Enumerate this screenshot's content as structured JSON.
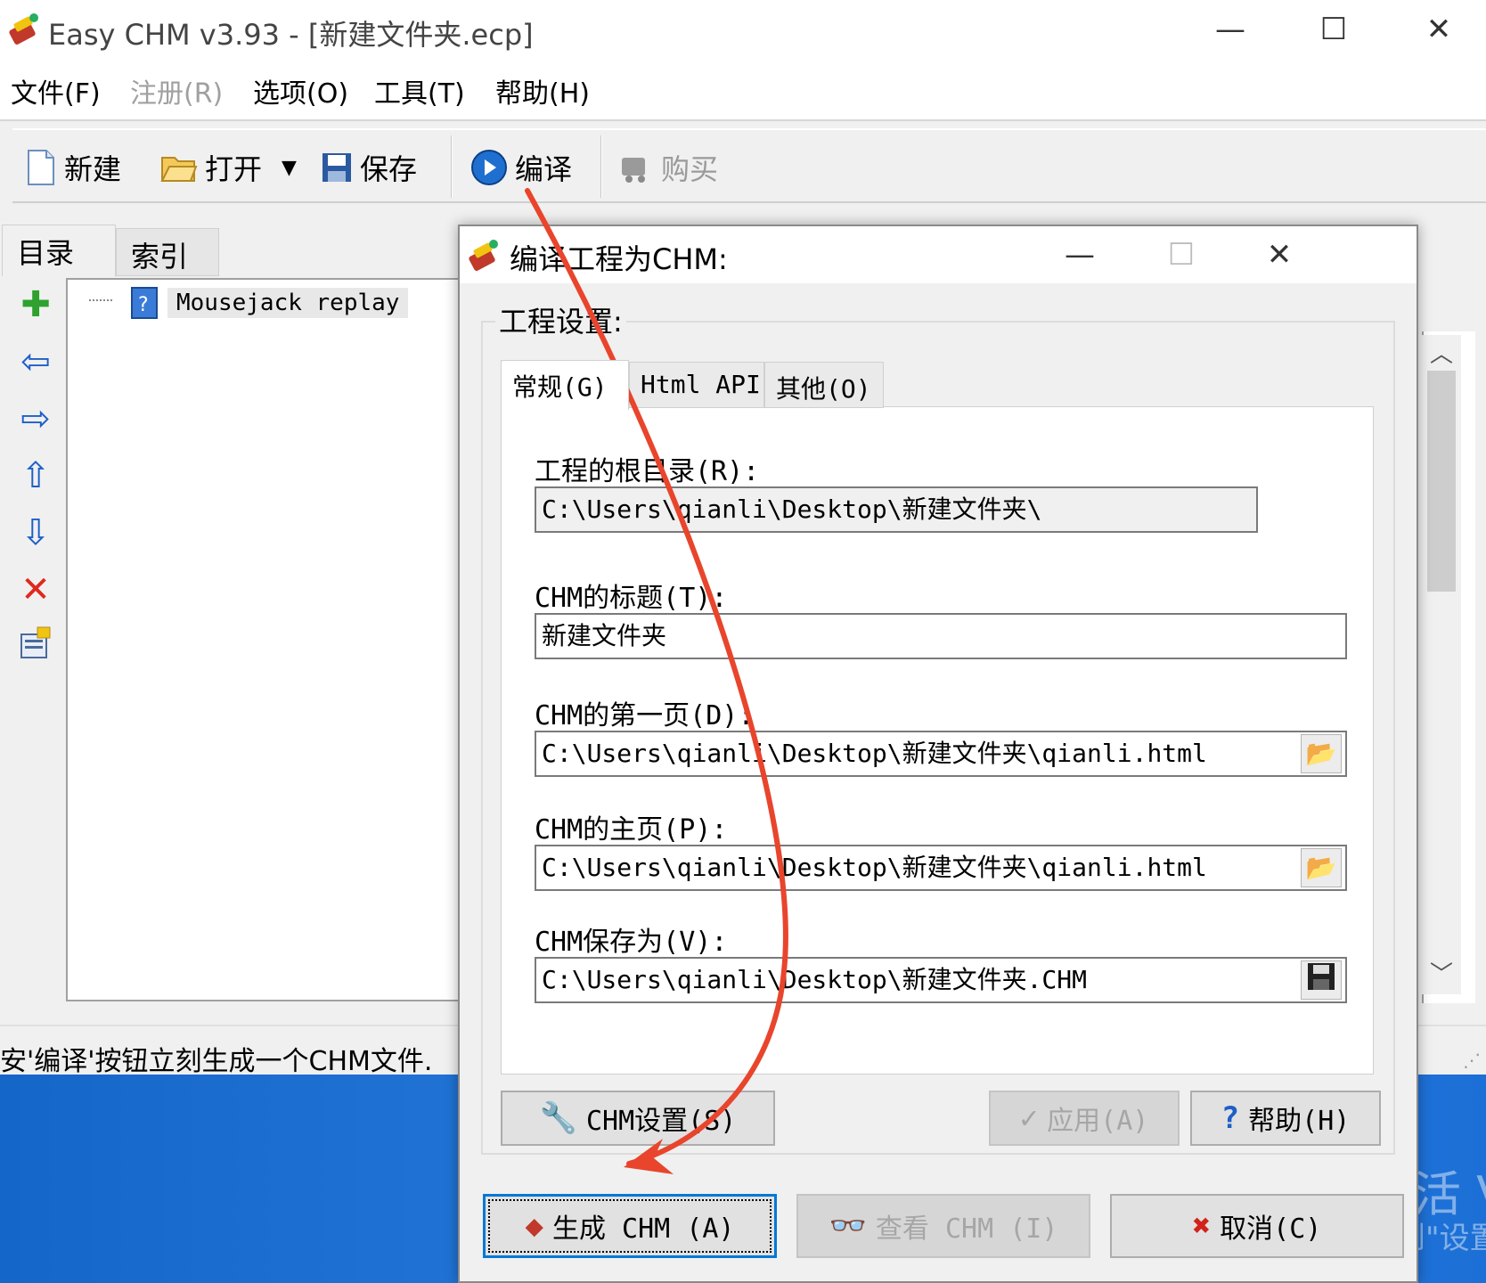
{
  "window": {
    "title": "Easy CHM v3.93 - [新建文件夹.ecp]",
    "minimize": "—",
    "maximize": "☐",
    "close": "✕"
  },
  "menu": {
    "file": "文件(F)",
    "register": "注册(R)",
    "options": "选项(O)",
    "tools": "工具(T)",
    "help": "帮助(H)"
  },
  "toolbar": {
    "new": "新建",
    "open": "打开",
    "save": "保存",
    "compile": "编译",
    "buy": "购买"
  },
  "left_tabs": {
    "toc": "目录",
    "index": "索引"
  },
  "tree": {
    "items": [
      "Mousejack replay"
    ]
  },
  "status_bar": {
    "text": "安'编译'按钮立刻生成一个CHM文件."
  },
  "watermark": {
    "line1": "激活 V",
    "line2": "转到\"设置"
  },
  "dialog": {
    "title": "编译工程为CHM:",
    "group_label": "工程设置:",
    "tabs": [
      "常规(G)",
      "Html API",
      "其他(O)"
    ],
    "fields": {
      "root_dir_label": "工程的根目录(R):",
      "root_dir_value": "C:\\Users\\qianli\\Desktop\\新建文件夹\\",
      "title_label": "CHM的标题(T):",
      "title_value": "新建文件夹",
      "first_page_label": "CHM的第一页(D):",
      "first_page_value": "C:\\Users\\qianli\\Desktop\\新建文件夹\\qianli.html",
      "home_page_label": "CHM的主页(P):",
      "home_page_value": "C:\\Users\\qianli\\Desktop\\新建文件夹\\qianli.html",
      "save_as_label": "CHM保存为(V):",
      "save_as_value": "C:\\Users\\qianli\\Desktop\\新建文件夹.CHM"
    },
    "buttons": {
      "chm_settings": "CHM设置(S)",
      "apply": "应用(A)",
      "help": "帮助(H)",
      "build": "生成 CHM (A)",
      "view": "查看 CHM (I)",
      "cancel": "取消(C)"
    }
  },
  "colors": {
    "annotation_arrow": "#e8452c",
    "desktop": "#1a6fd4",
    "focus_border": "#0078d7"
  }
}
